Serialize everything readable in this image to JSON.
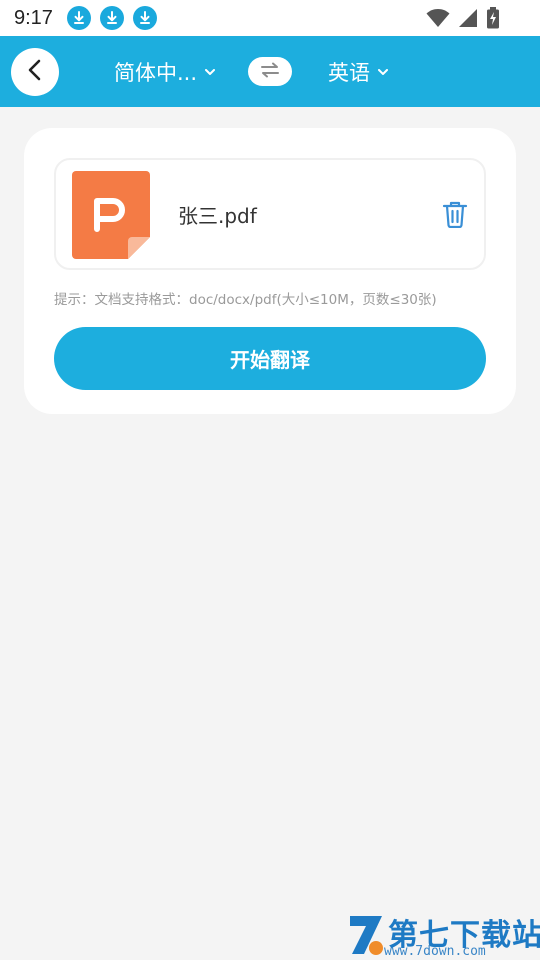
{
  "status_bar": {
    "time": "9:17",
    "notifications": [
      "download-icon",
      "download-icon",
      "download-icon"
    ],
    "indicators": [
      "wifi-icon",
      "signal-icon",
      "battery-charging-icon"
    ]
  },
  "header": {
    "background": "#1daede",
    "back_icon": "back-arrow-icon",
    "source_language": "简体中...",
    "target_language": "英语",
    "swap_icon": "swap-arrows-icon"
  },
  "file_card": {
    "file_icon": "wps-pdf-icon",
    "file_name": "张三.pdf",
    "delete_icon": "trash-icon",
    "hint": "提示：文档支持格式：doc/docx/pdf(大小≤10M，页数≤30张)",
    "start_button": "开始翻译"
  },
  "watermark": {
    "title": "第七下载站",
    "url": "www.7down.com"
  }
}
